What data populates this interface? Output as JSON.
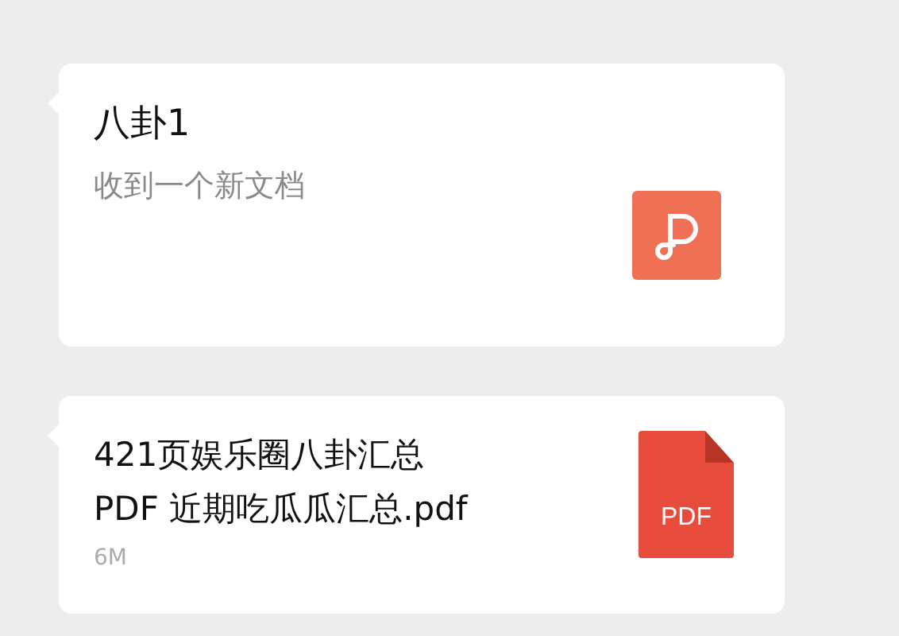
{
  "messages": [
    {
      "kind": "card",
      "title": "八卦1",
      "description": "收到一个新文档"
    },
    {
      "kind": "file",
      "title_lines": [
        "421页娱乐圈八卦汇总",
        "PDF 近期吃瓜瓜汇总.pdf"
      ],
      "size": "6M",
      "file_type": "PDF"
    }
  ]
}
